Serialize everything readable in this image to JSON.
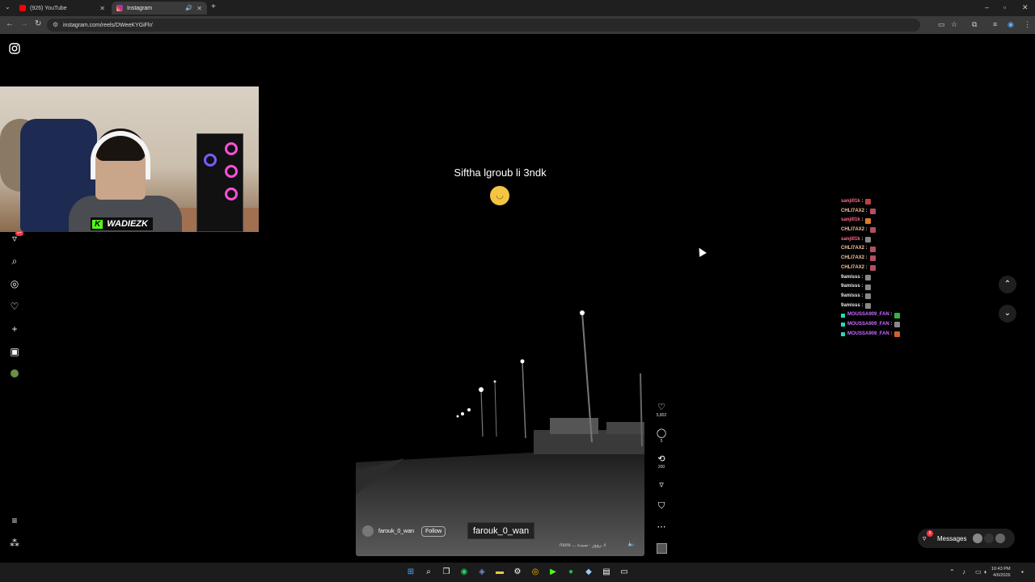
{
  "browser": {
    "tabs": [
      {
        "title": "(926) YouTube",
        "color": "#ff0000"
      },
      {
        "title": "Instagram",
        "color": "#e1306c"
      }
    ],
    "url": "instagram.com/reels/DWeeKYGiFlr/"
  },
  "webcam": {
    "streamer_tag": "WADIEZK",
    "kick_logo": "K",
    "brand_color": "#53fc18"
  },
  "sidebar": {
    "notifications_badge": "9+"
  },
  "reel": {
    "caption": "Siftha lgroub li 3ndk",
    "emoji": "relieved-face",
    "username": "farouk_0_wan",
    "follow_label": "Follow",
    "overlay_username": "farouk_0_wan",
    "audio_text": "more ... رووز ∙ سيدة ♬",
    "likes": "5,802",
    "comments": "5",
    "reposts": "200"
  },
  "chat": [
    {
      "user": "sanji01k",
      "color": "#ff6b8b",
      "emote": "#c04040"
    },
    {
      "user": "CHLI7AX2",
      "color": "#f5c6a0",
      "emote": "#b05060"
    },
    {
      "user": "sanji01k",
      "color": "#ff6b8b",
      "emote": "#e07a2a"
    },
    {
      "user": "CHLI7AX2",
      "color": "#f5c6a0",
      "emote": "#b05060"
    },
    {
      "user": "sanji01k",
      "color": "#ff6b8b",
      "emote": "#888888"
    },
    {
      "user": "CHLI7AX2",
      "color": "#f5c6a0",
      "emote": "#b05060"
    },
    {
      "user": "CHLI7AX2",
      "color": "#f5c6a0",
      "emote": "#b05060"
    },
    {
      "user": "CHLI7AX2",
      "color": "#f5c6a0",
      "emote": "#b05060"
    },
    {
      "user": "9amisss",
      "color": "#e8e8e8",
      "emote": "#888888"
    },
    {
      "user": "9amisss",
      "color": "#e8e8e8",
      "emote": "#888888"
    },
    {
      "user": "9amisss",
      "color": "#e8e8e8",
      "emote": "#888888"
    },
    {
      "user": "9amisss",
      "color": "#e8e8e8",
      "emote": "#888888"
    },
    {
      "user": "MOUSSA909_FAN",
      "color": "#c86bff",
      "emote": "#3cb043"
    },
    {
      "user": "MOUSSA909_FAN",
      "color": "#c86bff",
      "emote": "#888888"
    },
    {
      "user": "MOUSSA909_FAN",
      "color": "#c86bff",
      "emote": "#d06030"
    }
  ],
  "messages": {
    "label": "Messages",
    "badge": "8"
  },
  "taskbar": {
    "time": "10:43 PM",
    "date": "4/6/2026"
  }
}
